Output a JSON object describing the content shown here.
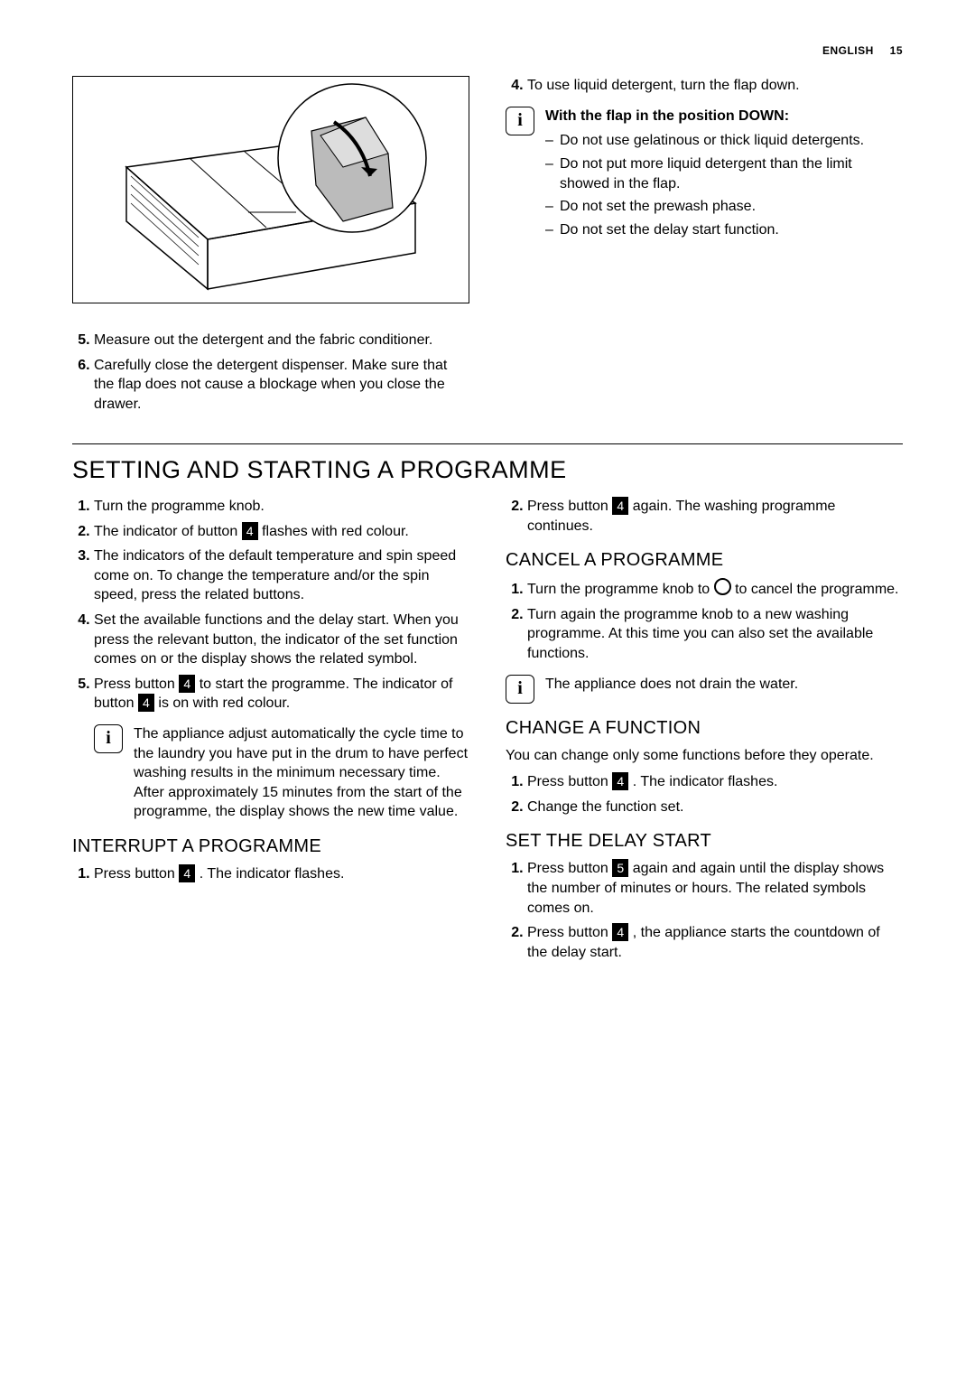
{
  "header": {
    "language": "ENGLISH",
    "page": "15"
  },
  "top_left": {
    "item5": "Measure out the detergent and the fabric conditioner.",
    "item6": "Carefully close the detergent dispenser. Make sure that the flap does not cause a blockage when you close the drawer."
  },
  "top_right": {
    "item4": "To use liquid detergent, turn the flap down.",
    "info_title": "With the flap in the position DOWN:",
    "dash1": "Do not use gelatinous or thick liquid detergents.",
    "dash2": "Do not put more liquid detergent than the limit showed in the flap.",
    "dash3": "Do not set the prewash phase.",
    "dash4": "Do not set the delay start function."
  },
  "main": {
    "title": "SETTING AND STARTING A PROGRAMME",
    "left": {
      "s1": "Turn the programme knob.",
      "s2a": "The indicator of button ",
      "s2b": " flashes with red colour.",
      "s3": "The indicators of the default temperature and spin speed come on. To change the temperature and/or the spin speed, press the related buttons.",
      "s4": "Set the available functions and the delay start. When you press the relevant button, the indicator of the set function comes on or the display shows the related symbol.",
      "s5a": "Press button ",
      "s5b": " to start the programme. The indicator of button ",
      "s5c": " is on with red colour.",
      "info": "The appliance adjust automatically the cycle time to the laundry you have put in the drum to have perfect washing results in the minimum necessary time. After approximately 15 minutes from the start of the programme, the display shows the new time value.",
      "interrupt_title": "INTERRUPT A PROGRAMME",
      "i1a": "Press button ",
      "i1b": " . The indicator flashes."
    },
    "right": {
      "i2a": "Press button ",
      "i2b": " again. The washing programme continues.",
      "cancel_title": "CANCEL A PROGRAMME",
      "c1a": "Turn the programme knob to ",
      "c1b": " to cancel the programme.",
      "c2": "Turn again the programme knob to a new washing programme. At this time you can also set the available functions.",
      "cancel_info": "The appliance does not drain the water.",
      "change_title": "CHANGE A FUNCTION",
      "change_intro": "You can change only some functions before they operate.",
      "ch1a": "Press button ",
      "ch1b": " . The indicator flashes.",
      "ch2": "Change the function set.",
      "delay_title": "SET THE DELAY START",
      "d1a": "Press button ",
      "d1b": " again and again until the display shows the number of minutes or hours. The related symbols comes on.",
      "d2a": "Press button ",
      "d2b": " , the appliance starts the countdown of the delay start."
    }
  },
  "buttons": {
    "b4": "4",
    "b5": "5"
  }
}
